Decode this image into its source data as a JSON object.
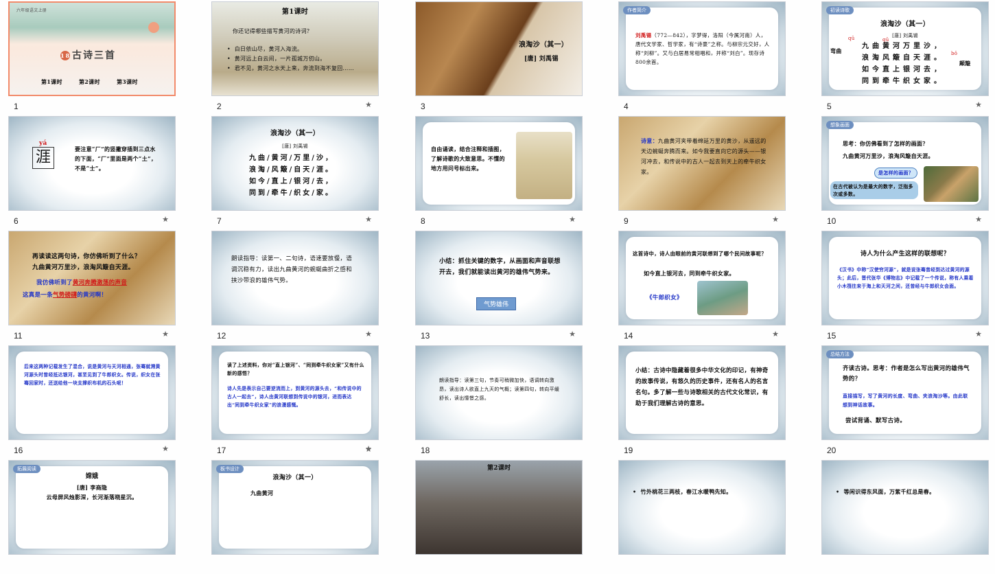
{
  "slides": [
    {
      "num": "1",
      "star": "",
      "grade": "六年级语文上册",
      "lesson_no": "18",
      "title": "古诗三首",
      "periods": [
        "第1课时",
        "第2课时",
        "第3课时"
      ]
    },
    {
      "num": "2",
      "star": "★",
      "heading": "第1课时",
      "question": "你还记得哪些描写黄河的诗词？",
      "bullets": [
        "白日依山尽，黄河入海流。",
        "黄河远上白云间，一片孤城万仞山。",
        "君不见，黄河之水天上来，奔流到海不复回……"
      ]
    },
    {
      "num": "3",
      "star": "",
      "title": "浪淘沙（其一）",
      "author": "[唐] 刘禹锡"
    },
    {
      "num": "4",
      "star": "",
      "tag": "作者简介",
      "name": "刘禹锡",
      "bio": "（772—842），字梦得，洛阳（今属河南）人，唐代文学家、哲学家，有“诗豪”之称。与柳宗元交好，人称“刘柳”。又与白居易常相唱和，并称“刘白”。现存诗800余首。"
    },
    {
      "num": "5",
      "star": "★",
      "tag": "初读诗歌",
      "title": "浪淘沙（其一）",
      "author": "[唐] 刘禹锡",
      "lines": [
        "九曲黄河万里沙，",
        "浪淘风簸自天涯。",
        "如今直上银河去，",
        "同到牵牛织女家。"
      ],
      "ann_left": "qū",
      "ann_left_word": "弯曲",
      "ann_mid": "qū",
      "ann_right": "bǒ",
      "ann_right_word": "颠簸"
    },
    {
      "num": "6",
      "star": "★",
      "pinyin": "yá",
      "char": "涯",
      "note": "要注意“厂”的竖撇穿插到三点水的下面，“厂”里面是两个“土”，不是“士”。"
    },
    {
      "num": "7",
      "star": "★",
      "title": "浪淘沙（其一）",
      "author": "[唐] 刘禹锡",
      "lines": [
        "九曲/黄河/万里/沙，",
        "浪淘/风簸/自天/涯。",
        "如今/直上/银河/去，",
        "同到/牵牛/织女/家。"
      ]
    },
    {
      "num": "8",
      "star": "★",
      "text": "自由诵读，结合注释和插图，了解诗歌的大致意思。不懂的地方用问号标出来。"
    },
    {
      "num": "9",
      "star": "★",
      "label": "诗意：",
      "text": "九曲黄河夹带着绵延万里的黄沙，从遥远的天边蜿蜒奔腾而来。如今我要直向它的源头——银河冲去，和传说中的古人一起去到天上的牵牛织女家。"
    },
    {
      "num": "10",
      "star": "★",
      "tag": "想象画面",
      "question": "思考：你仿佛看到了怎样的画面？",
      "line": "九曲黄河万里沙，浪淘风簸自天涯。",
      "bubble": "是怎样的画面？",
      "note": "在古代被认为是最大的数字，泛指多次或多数。"
    },
    {
      "num": "11",
      "star": "★",
      "q": "再读读这两句诗，你仿佛听到了什么？",
      "line": "九曲黄河万里沙，浪淘风簸自天涯。",
      "p1": "我仿佛听到了",
      "fill1": "黄河奔腾激荡的声音",
      "p2": "这真是一条",
      "fill2": "气势磅礴",
      "p3": "的黄河啊！"
    },
    {
      "num": "12",
      "star": "★",
      "text": "朗读指导：读第一、二句诗，语速要放慢，语调沉稳有力，读出九曲黄河的蜿蜒曲折之感和挟沙带浪的雄伟气势。"
    },
    {
      "num": "13",
      "star": "★",
      "text": "小结：抓住关键的数字，从画面和声音联想开去，我们就能读出黄河的雄伟气势来。",
      "pill": "气势雄伟"
    },
    {
      "num": "14",
      "star": "★",
      "q": "这首诗中，诗人由眼前的黄河联想到了哪个民间故事呢？",
      "line": "如今直上银河去，同到牵牛织女家。",
      "story": "《牛郎织女》"
    },
    {
      "num": "15",
      "star": "★",
      "q": "诗人为什么产生这样的联想呢？",
      "text": "《汉书》中称“汉使穷河源”，就是说张骞曾经到达过黄河的源头；此后，晋代张华《博物志》中记载了一个传说，称有人乘着小木筏往来于海上和天河之间，还曾经与牛郎织女会面。"
    },
    {
      "num": "16",
      "star": "★",
      "text": "后来这两种记载发生了混合，说是黄河与天河相通，张骞就溯黄河源头时曾经抵达银河，甚至见到了牛郎织女。传说，织女在张骞回家时，还送给他一块支撑织布机的石头呢！"
    },
    {
      "num": "17",
      "star": "★",
      "q": "读了上述资料，你对“直上银河”、“同到牵牛织女家”又有什么新的感悟？",
      "text": "诗人先是表示自己要逆流而上，到黄河的源头去，“和传说中的古人一起去”，诗人由黄河联想到传说中的银河，进而表达出“同到牵牛织女家”的浪漫感慨。"
    },
    {
      "num": "18",
      "star": "",
      "text": "朗读指导：读第三句，节奏可稍微加快，语调转向激昂，读出诗人欲直上九天的气概；读第四句，转向平缓舒长，读出憧憬之感。"
    },
    {
      "num": "19",
      "star": "",
      "text": "小结：古诗中隐藏着很多中华文化的印记，有神奇的故事传说，有悠久的历史事件，还有名人的名言名句。多了解一些与诗歌相关的古代文化常识，有助于我们理解古诗的意思。"
    },
    {
      "num": "20",
      "star": "",
      "tag": "总结方法",
      "q": "齐读古诗。思考：作者是怎么写出黄河的雄伟气势的？",
      "text": "直接描写，写了黄河的长度、弯曲、夹浪淘沙等。由此联想到神话故事。",
      "tail": "尝试背诵、默写古诗。"
    },
    {
      "num": "21",
      "star": "",
      "tag": "拓展阅读",
      "title": "嫦娥",
      "author": "[唐] 李商隐",
      "line": "云母屏风烛影深，长河渐落晓星沉。"
    },
    {
      "num": "22",
      "star": "",
      "tag": "板书设计",
      "title": "浪淘沙（其一）",
      "line": "九曲黄河"
    },
    {
      "num": "23",
      "star": "",
      "heading": "第2课时"
    },
    {
      "num": "24",
      "star": "",
      "bullet": "竹外桃花三两枝，春江水暖鸭先知。"
    },
    {
      "num": "25",
      "star": "",
      "bullet": "等闲识得东风面，万紫千红总是春。"
    }
  ],
  "colors": {
    "selected_border": "#f28a6a",
    "accent_blue": "#2336c8",
    "accent_red": "#d01818",
    "tag_blue": "#6d8fc0"
  }
}
